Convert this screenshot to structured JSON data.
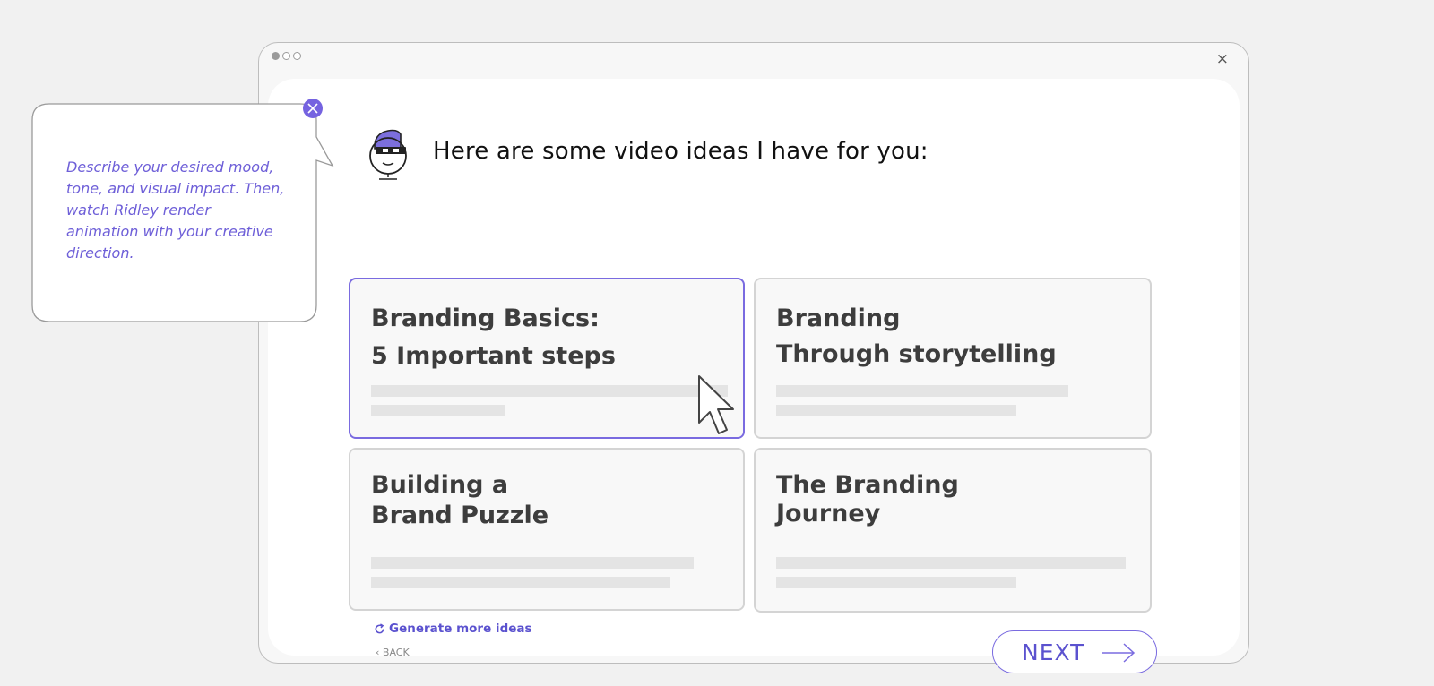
{
  "window": {
    "close_symbol": "×"
  },
  "main": {
    "heading": "Here are some video ideas I have for you:",
    "ideas": [
      {
        "line1": "Branding Basics:",
        "line2": "5 Important steps",
        "selected": true
      },
      {
        "line1": "Branding",
        "line2": "Through storytelling",
        "selected": false
      },
      {
        "line1": "Building a",
        "line2": "Brand Puzzle",
        "selected": false
      },
      {
        "line1": "The Branding",
        "line2": "Journey",
        "selected": false
      }
    ],
    "generate_label": "Generate more ideas",
    "back_label": "‹ BACK",
    "next_label": "NEXT"
  },
  "tooltip": {
    "text": "Describe your desired mood, tone, and visual impact. Then, watch Ridley render animation with your creative direction."
  },
  "colors": {
    "accent": "#7a6be0",
    "accent_text": "#5b52cf",
    "card_border": "#d4d4d4",
    "background": "#f1f1f1"
  },
  "icons": [
    "close-icon",
    "refresh-icon",
    "arrow-right-icon",
    "mouse-cursor-icon",
    "avatar-icon",
    "tooltip-close-icon"
  ]
}
